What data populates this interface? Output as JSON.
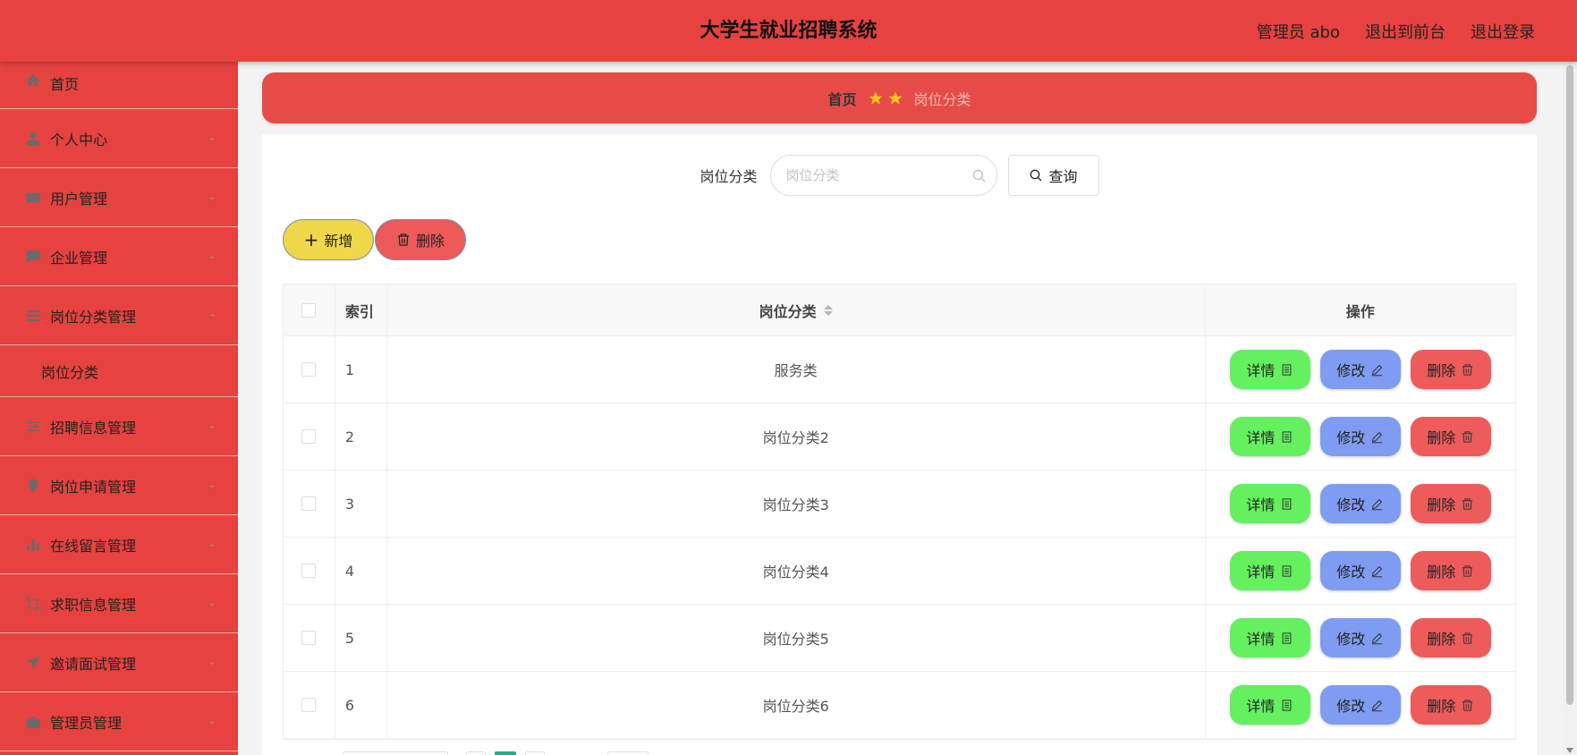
{
  "header": {
    "title": "大学生就业招聘系统",
    "user": "管理员 abo",
    "to_front": "退出到前台",
    "logout": "退出登录"
  },
  "sidebar": {
    "items": [
      {
        "label": "首页",
        "icon": "home-icon"
      },
      {
        "label": "个人中心",
        "icon": "user-icon"
      },
      {
        "label": "用户管理",
        "icon": "mail-icon"
      },
      {
        "label": "企业管理",
        "icon": "chat-icon"
      },
      {
        "label": "岗位分类管理",
        "icon": "list-icon",
        "expanded": true
      },
      {
        "label": "招聘信息管理",
        "icon": "sliders-icon"
      },
      {
        "label": "岗位申请管理",
        "icon": "pin-icon"
      },
      {
        "label": "在线留言管理",
        "icon": "bar-chart-icon"
      },
      {
        "label": "求职信息管理",
        "icon": "crop-icon"
      },
      {
        "label": "邀请面试管理",
        "icon": "send-icon"
      },
      {
        "label": "管理员管理",
        "icon": "briefcase-icon"
      }
    ],
    "submenu": {
      "label": "岗位分类"
    }
  },
  "breadcrumb": {
    "home": "首页",
    "current": "岗位分类"
  },
  "search": {
    "label": "岗位分类",
    "placeholder": "岗位分类",
    "value": "",
    "button": "查询"
  },
  "actions": {
    "add": "新增",
    "delete": "删除"
  },
  "table": {
    "headers": {
      "index": "索引",
      "name": "岗位分类",
      "ops": "操作"
    },
    "rows": [
      {
        "index": "1",
        "name": "服务类"
      },
      {
        "index": "2",
        "name": "岗位分类2"
      },
      {
        "index": "3",
        "name": "岗位分类3"
      },
      {
        "index": "4",
        "name": "岗位分类4"
      },
      {
        "index": "5",
        "name": "岗位分类5"
      },
      {
        "index": "6",
        "name": "岗位分类6"
      }
    ],
    "op_labels": {
      "detail": "详情",
      "edit": "修改",
      "delete": "删除"
    }
  },
  "colors": {
    "primary": "#e6423f",
    "detail": "#64f05f",
    "edit": "#7f9cf2",
    "danger": "#ed5b5b",
    "add": "#f1d74a",
    "pager_active": "#12b886"
  }
}
